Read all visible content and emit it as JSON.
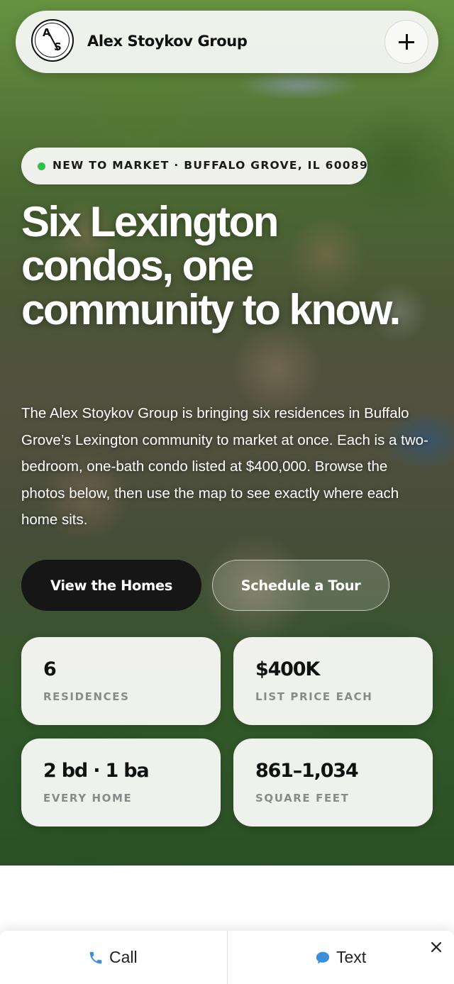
{
  "header": {
    "logo_letters": "A/S",
    "brand": "Alex Stoykov Group"
  },
  "hero": {
    "badge": "NEW TO MARKET · BUFFALO GROVE, IL 60089",
    "headline": "Six Lexington condos, one community to know.",
    "description": "The Alex Stoykov Group is bringing six residences in Buffalo Grove’s Lexington community to market at once. Each is a two-bedroom, one-bath condo listed at $400,000. Browse the photos below, then use the map to see exactly where each home sits.",
    "primary_cta": "View the Homes",
    "secondary_cta": "Schedule a Tour"
  },
  "stats": [
    {
      "value": "6",
      "label": "RESIDENCES"
    },
    {
      "value": "$400K",
      "label": "LIST PRICE EACH"
    },
    {
      "value": "2 bd · 1 ba",
      "label": "EVERY HOME"
    },
    {
      "value": "861–1,034",
      "label": "SQUARE FEET"
    }
  ],
  "contact_bar": {
    "call_label": "Call",
    "text_label": "Text"
  },
  "colors": {
    "status_dot": "#2fbf4b",
    "primary_button": "#161616",
    "contact_icon": "#3b8ed8"
  }
}
